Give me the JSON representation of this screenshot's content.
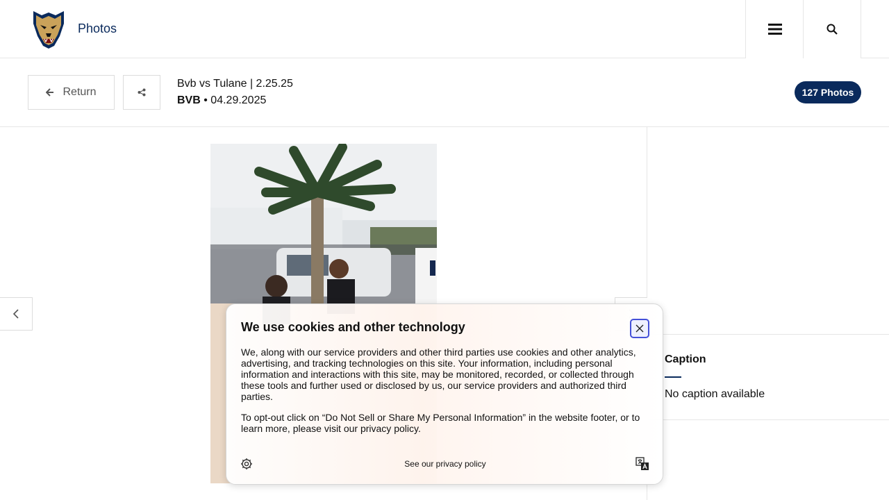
{
  "header": {
    "brand": "Photos",
    "logo_icon": "panther-logo-icon",
    "menu_icon": "hamburger-menu-icon",
    "search_icon": "search-icon"
  },
  "gallery": {
    "return_label": "Return",
    "title": "Bvb vs Tulane | 2.25.25",
    "sport": "BVB",
    "separator": "•",
    "date": "04.29.2025",
    "photo_count": "127 Photos"
  },
  "caption": {
    "heading": "Caption",
    "text": "No caption available"
  },
  "cookie": {
    "title": "We use cookies and other technology",
    "paragraph1": "We, along with our service providers and other third parties use cookies and other analytics, advertising, and tracking technologies on this site. Your information, including personal information and interactions with this site, may be monitored, recorded, or collected through these tools and further used or disclosed by us, our service providers and authorized third parties.",
    "paragraph2": "To opt-out click on “Do Not Sell or Share My Personal Information” in the website footer, or to learn more, please visit our privacy policy.",
    "privacy_link": "See our privacy policy"
  },
  "colors": {
    "brand_navy": "#0a2a5c",
    "focus_blue": "#4450d8"
  }
}
